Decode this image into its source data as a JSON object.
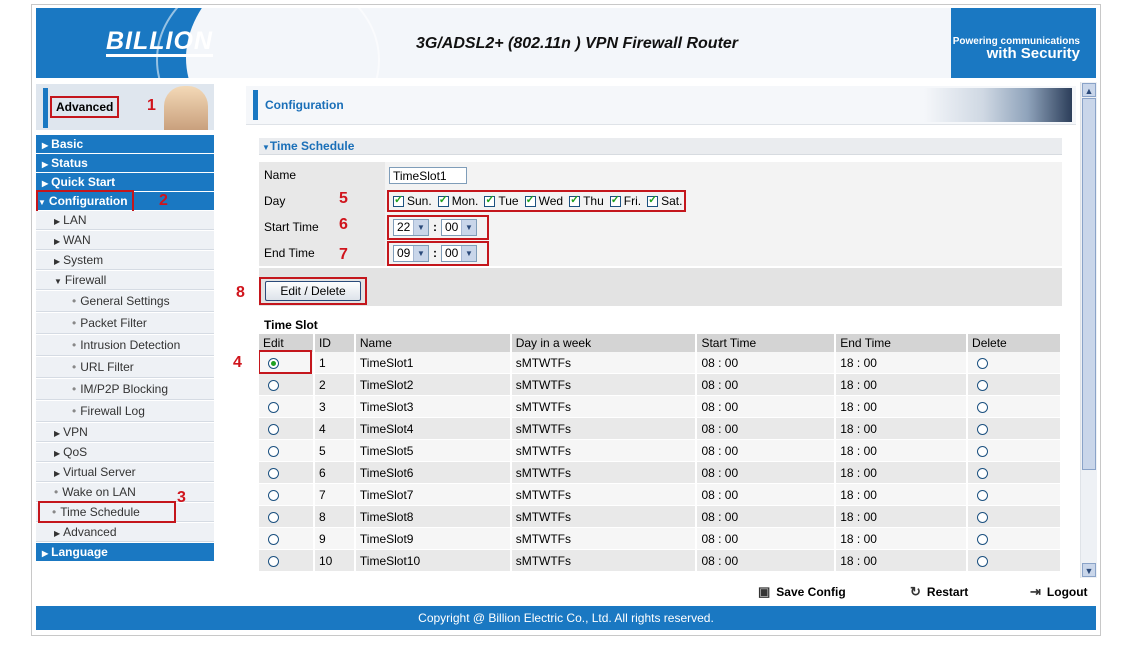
{
  "header": {
    "logo": "BILLION",
    "title": "3G/ADSL2+ (802.11n ) VPN Firewall Router",
    "slogan_line1": "Powering communications",
    "slogan_line2": "with Security"
  },
  "sidebar": {
    "mode_label": "Advanced",
    "items": [
      {
        "label": "Basic"
      },
      {
        "label": "Status"
      },
      {
        "label": "Quick Start"
      },
      {
        "label": "Configuration"
      },
      {
        "label": "LAN"
      },
      {
        "label": "WAN"
      },
      {
        "label": "System"
      },
      {
        "label": "Firewall"
      },
      {
        "label": "General Settings"
      },
      {
        "label": "Packet Filter"
      },
      {
        "label": "Intrusion Detection"
      },
      {
        "label": "URL Filter"
      },
      {
        "label": "IM/P2P Blocking"
      },
      {
        "label": "Firewall Log"
      },
      {
        "label": "VPN"
      },
      {
        "label": "QoS"
      },
      {
        "label": "Virtual Server"
      },
      {
        "label": "Wake on LAN"
      },
      {
        "label": "Time Schedule"
      },
      {
        "label": "Advanced"
      },
      {
        "label": "Language"
      }
    ]
  },
  "annotations": [
    "1",
    "2",
    "3",
    "4",
    "5",
    "6",
    "7",
    "8"
  ],
  "main": {
    "page_title": "Configuration",
    "section_title": "Time Schedule",
    "form": {
      "name_label": "Name",
      "name_value": "TimeSlot1",
      "day_label": "Day",
      "days": [
        "Sun.",
        "Mon.",
        "Tue",
        "Wed",
        "Thu",
        "Fri.",
        "Sat."
      ],
      "start_label": "Start Time",
      "start_hour": "22",
      "start_min": "00",
      "end_label": "End Time",
      "end_hour": "09",
      "end_min": "00",
      "colon": ":",
      "edit_button": "Edit / Delete"
    },
    "timeslot": {
      "title": "Time Slot",
      "headers": [
        "Edit",
        "ID",
        "Name",
        "Day in a week",
        "Start Time",
        "End Time",
        "Delete"
      ],
      "rows": [
        {
          "id": "1",
          "name": "TimeSlot1",
          "days": "sMTWTFs",
          "start": "08 : 00",
          "end": "18 : 00"
        },
        {
          "id": "2",
          "name": "TimeSlot2",
          "days": "sMTWTFs",
          "start": "08 : 00",
          "end": "18 : 00"
        },
        {
          "id": "3",
          "name": "TimeSlot3",
          "days": "sMTWTFs",
          "start": "08 : 00",
          "end": "18 : 00"
        },
        {
          "id": "4",
          "name": "TimeSlot4",
          "days": "sMTWTFs",
          "start": "08 : 00",
          "end": "18 : 00"
        },
        {
          "id": "5",
          "name": "TimeSlot5",
          "days": "sMTWTFs",
          "start": "08 : 00",
          "end": "18 : 00"
        },
        {
          "id": "6",
          "name": "TimeSlot6",
          "days": "sMTWTFs",
          "start": "08 : 00",
          "end": "18 : 00"
        },
        {
          "id": "7",
          "name": "TimeSlot7",
          "days": "sMTWTFs",
          "start": "08 : 00",
          "end": "18 : 00"
        },
        {
          "id": "8",
          "name": "TimeSlot8",
          "days": "sMTWTFs",
          "start": "08 : 00",
          "end": "18 : 00"
        },
        {
          "id": "9",
          "name": "TimeSlot9",
          "days": "sMTWTFs",
          "start": "08 : 00",
          "end": "18 : 00"
        },
        {
          "id": "10",
          "name": "TimeSlot10",
          "days": "sMTWTFs",
          "start": "08 : 00",
          "end": "18 : 00"
        }
      ]
    }
  },
  "toolbar": {
    "save": "Save Config",
    "restart": "Restart",
    "logout": "Logout"
  },
  "footer": {
    "copyright": "Copyright @ Billion Electric Co., Ltd. All rights reserved."
  }
}
